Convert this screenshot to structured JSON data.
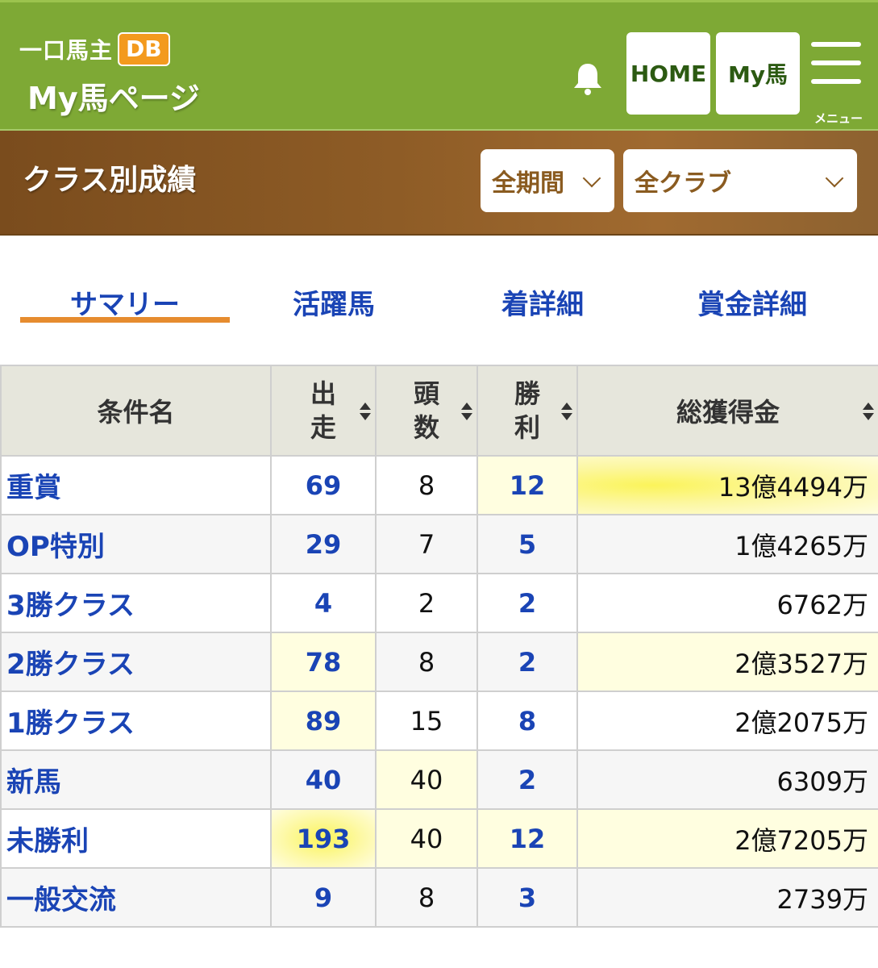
{
  "header": {
    "logo_text": "一口馬主",
    "logo_badge": "DB",
    "page_title": "My馬ページ",
    "home_button": "HOME",
    "myuma_button": "My馬",
    "menu_label": "メニュー"
  },
  "band": {
    "title": "クラス別成績",
    "period_select": "全期間",
    "club_select": "全クラブ"
  },
  "tabs": [
    {
      "label": "サマリー",
      "active": true
    },
    {
      "label": "活躍馬",
      "active": false
    },
    {
      "label": "着詳細",
      "active": false
    },
    {
      "label": "賞金詳細",
      "active": false
    }
  ],
  "table": {
    "headers": {
      "name": "条件名",
      "starts": [
        "出",
        "走"
      ],
      "horses": [
        "頭",
        "数"
      ],
      "wins": [
        "勝",
        "利"
      ],
      "prize": "総獲得金"
    },
    "rows": [
      {
        "name": "重賞",
        "starts": "69",
        "horses": "8",
        "wins": "12",
        "prize": "13億4494万"
      },
      {
        "name": "OP特別",
        "starts": "29",
        "horses": "7",
        "wins": "5",
        "prize": "1億4265万"
      },
      {
        "name": "3勝クラス",
        "starts": "4",
        "horses": "2",
        "wins": "2",
        "prize": "6762万"
      },
      {
        "name": "2勝クラス",
        "starts": "78",
        "horses": "8",
        "wins": "2",
        "prize": "2億3527万"
      },
      {
        "name": "1勝クラス",
        "starts": "89",
        "horses": "15",
        "wins": "8",
        "prize": "2億2075万"
      },
      {
        "name": "新馬",
        "starts": "40",
        "horses": "40",
        "wins": "2",
        "prize": "6309万"
      },
      {
        "name": "未勝利",
        "starts": "193",
        "horses": "40",
        "wins": "12",
        "prize": "2億7205万"
      },
      {
        "name": "一般交流",
        "starts": "9",
        "horses": "8",
        "wins": "3",
        "prize": "2739万"
      }
    ]
  },
  "colors": {
    "header_green": "#7ea935",
    "band_brown": "#8e5c26",
    "link_blue": "#1a44b5",
    "tab_underline": "#e68c2f",
    "highlight": "#fbf45a"
  }
}
